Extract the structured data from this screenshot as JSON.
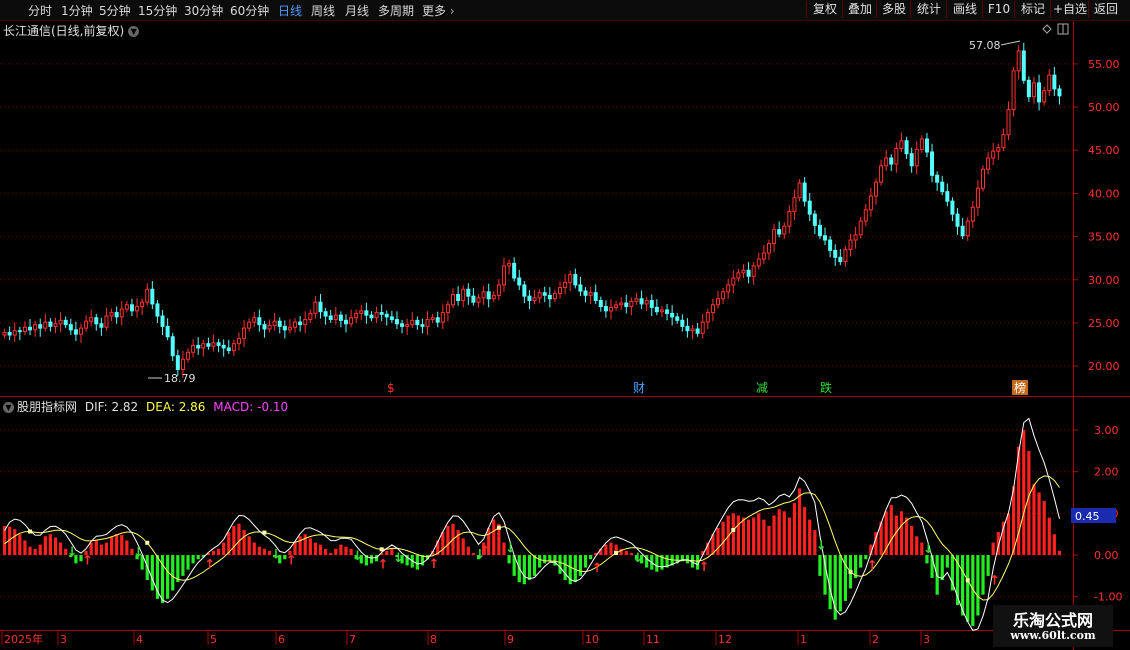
{
  "toolbar": {
    "left_tabs": [
      "分时",
      "1分钟",
      "5分钟",
      "15分钟",
      "30分钟",
      "60分钟",
      "日线",
      "周线",
      "月线",
      "多周期",
      "更多"
    ],
    "active_tab": "日线",
    "right_buttons": [
      "复权",
      "叠加",
      "多股",
      "统计",
      "画线",
      "F10",
      "标记",
      "+自选",
      "返回"
    ]
  },
  "main_panel": {
    "title": "长江通信(日线,前复权)",
    "high_label": "57.08",
    "low_label": "18.79",
    "y_ticks": [
      "55.00",
      "50.00",
      "45.00",
      "40.00",
      "35.00",
      "30.00",
      "25.00",
      "20.00"
    ],
    "event_markers": [
      {
        "text": "$",
        "color": "#ff3030"
      },
      {
        "text": "财",
        "color": "#4aa0ff"
      },
      {
        "text": "减",
        "color": "#33dd33"
      },
      {
        "text": "跌",
        "color": "#33dd33"
      },
      {
        "text": "榜",
        "color": "#ffffff"
      }
    ],
    "price_range": [
      17,
      58
    ],
    "candles": [
      23.9,
      23.6,
      24.1,
      24.0,
      24.5,
      24.2,
      24.8,
      24.4,
      25.1,
      24.6,
      24.9,
      25.3,
      24.8,
      24.2,
      23.7,
      24.4,
      25.2,
      25.6,
      24.9,
      24.5,
      25.8,
      26.2,
      25.7,
      26.6,
      27.1,
      26.4,
      26.9,
      27.4,
      28.9,
      27.2,
      25.8,
      24.6,
      23.4,
      21.2,
      19.6,
      20.8,
      21.6,
      22.4,
      22.1,
      22.6,
      22.3,
      22.7,
      22.4,
      22.1,
      21.8,
      22.6,
      23.2,
      24.4,
      25.1,
      25.6,
      24.8,
      24.3,
      24.7,
      25.2,
      24.6,
      24.2,
      24.5,
      25.1,
      24.8,
      25.4,
      26.1,
      27.4,
      26.3,
      25.8,
      25.4,
      25.9,
      25.3,
      24.9,
      25.6,
      26.1,
      26.4,
      25.9,
      25.6,
      26.2,
      26.0,
      25.7,
      25.4,
      24.9,
      24.6,
      24.8,
      25.3,
      24.8,
      24.6,
      25.4,
      25.6,
      25.1,
      26.2,
      27.1,
      28.3,
      27.6,
      28.9,
      28.1,
      27.4,
      27.9,
      28.6,
      27.8,
      28.2,
      29.4,
      31.6,
      31.9,
      30.2,
      29.4,
      28.1,
      27.6,
      27.9,
      28.5,
      28.2,
      27.8,
      28.4,
      29.1,
      29.7,
      30.6,
      29.4,
      28.7,
      28.2,
      28.5,
      27.6,
      26.9,
      26.4,
      26.8,
      27.1,
      27.3,
      26.9,
      27.5,
      27.8,
      27.2,
      27.6,
      26.8,
      26.3,
      26.5,
      26.1,
      25.7,
      25.3,
      24.6,
      24.1,
      24.3,
      23.8,
      25.1,
      26.2,
      27.1,
      27.8,
      28.6,
      29.4,
      30.2,
      30.8,
      31.1,
      30.4,
      31.6,
      32.4,
      33.1,
      34.2,
      35.8,
      35.3,
      36.2,
      37.9,
      39.5,
      41.2,
      39.1,
      37.6,
      36.3,
      35.1,
      34.6,
      33.4,
      32.6,
      32.1,
      33.5,
      34.6,
      35.2,
      36.8,
      38.1,
      39.7,
      41.3,
      43.2,
      44.1,
      43.4,
      45.2,
      46.1,
      44.6,
      43.2,
      45.1,
      46.3,
      44.8,
      42.1,
      41.3,
      40.2,
      39.1,
      37.6,
      36.2,
      35.1,
      36.8,
      38.4,
      40.6,
      42.8,
      44.1,
      44.9,
      45.3,
      46.8,
      49.7,
      54.2,
      56.5,
      53.1,
      51.2,
      52.8,
      50.6,
      51.9,
      53.7,
      52.1,
      51.3
    ]
  },
  "macd_panel": {
    "title": "股朋指标网",
    "dif_label": "DIF:",
    "dif_value": "2.82",
    "dea_label": "DEA:",
    "dea_value": "2.86",
    "macd_label": "MACD:",
    "macd_value": "-0.10",
    "y_ticks": [
      "3.00",
      "2.00",
      "1.00",
      "0.00",
      "-1.00"
    ],
    "current_value": "0.45",
    "value_range": [
      -1.75,
      3.6
    ],
    "histogram": [
      0.7,
      0.68,
      0.62,
      0.5,
      0.35,
      0.2,
      0.15,
      0.25,
      0.45,
      0.5,
      0.42,
      0.3,
      0.15,
      -0.05,
      -0.2,
      -0.15,
      0.1,
      0.3,
      0.35,
      0.25,
      0.3,
      0.45,
      0.5,
      0.48,
      0.35,
      0.15,
      -0.1,
      -0.35,
      -0.6,
      -0.85,
      -1.05,
      -1.15,
      -1.05,
      -0.85,
      -0.65,
      -0.5,
      -0.35,
      -0.2,
      -0.1,
      -0.05,
      0.05,
      0.1,
      0.15,
      0.3,
      0.55,
      0.7,
      0.75,
      0.6,
      0.45,
      0.3,
      0.2,
      0.15,
      0.1,
      -0.05,
      -0.2,
      -0.1,
      0.1,
      0.3,
      0.45,
      0.5,
      0.4,
      0.3,
      0.25,
      0.15,
      0.05,
      0.15,
      0.25,
      0.2,
      0.15,
      -0.1,
      -0.2,
      -0.25,
      -0.2,
      -0.15,
      0.05,
      0.1,
      0.15,
      -0.05,
      -0.2,
      -0.25,
      -0.3,
      -0.35,
      -0.25,
      -0.1,
      0.1,
      0.35,
      0.55,
      0.7,
      0.75,
      0.6,
      0.4,
      0.2,
      0.05,
      -0.1,
      0.3,
      0.65,
      0.85,
      0.75,
      0.3,
      -0.2,
      -0.5,
      -0.65,
      -0.7,
      -0.6,
      -0.5,
      -0.3,
      -0.2,
      -0.15,
      -0.25,
      -0.45,
      -0.6,
      -0.7,
      -0.65,
      -0.5,
      -0.3,
      -0.1,
      0.05,
      0.15,
      0.25,
      0.3,
      0.25,
      0.15,
      0.1,
      0.05,
      -0.1,
      -0.2,
      -0.3,
      -0.35,
      -0.4,
      -0.35,
      -0.3,
      -0.25,
      -0.2,
      -0.15,
      -0.2,
      -0.3,
      -0.35,
      0.1,
      0.3,
      0.5,
      0.65,
      0.8,
      0.95,
      1.0,
      0.95,
      0.9,
      0.85,
      0.9,
      1.0,
      0.85,
      0.7,
      0.95,
      1.1,
      1.05,
      0.9,
      1.25,
      1.6,
      1.15,
      0.85,
      0.6,
      -0.5,
      -0.95,
      -1.3,
      -1.55,
      -1.35,
      -1.1,
      -0.8,
      -0.55,
      -0.3,
      -0.1,
      0.25,
      0.55,
      0.8,
      1.05,
      1.2,
      0.95,
      1.05,
      0.9,
      0.7,
      0.45,
      0.3,
      -0.2,
      -0.55,
      -0.95,
      -0.6,
      -0.3,
      -0.85,
      -1.2,
      -1.45,
      -1.6,
      -1.7,
      -1.45,
      -0.95,
      -0.5,
      0.3,
      0.55,
      0.8,
      1.0,
      1.65,
      2.6,
      3.0,
      2.5,
      1.7,
      1.5,
      1.3,
      0.9,
      0.5,
      0.1
    ],
    "markers": [
      {
        "text": "↓",
        "color": "#33dd33"
      },
      {
        "text": "↑",
        "color": "#ff3030"
      },
      {
        "text": "ᴥ",
        "color": "#ff9d3a"
      }
    ]
  },
  "time_axis": {
    "labels": [
      "2025年",
      "3",
      "4",
      "5",
      "6",
      "7",
      "8",
      "9",
      "10",
      "11",
      "12",
      "1",
      "2",
      "3"
    ]
  },
  "watermark": {
    "line1": "乐淘公式网",
    "line2": "www.60lt.com"
  },
  "colors": {
    "up": "#ff3030",
    "down": "#54ffff",
    "hist_up": "#ff2020",
    "hist_down": "#22ee22",
    "dif": "#ffffff",
    "dea": "#ffff66",
    "grid": "#7a0000",
    "accent": "#4f9bff"
  }
}
